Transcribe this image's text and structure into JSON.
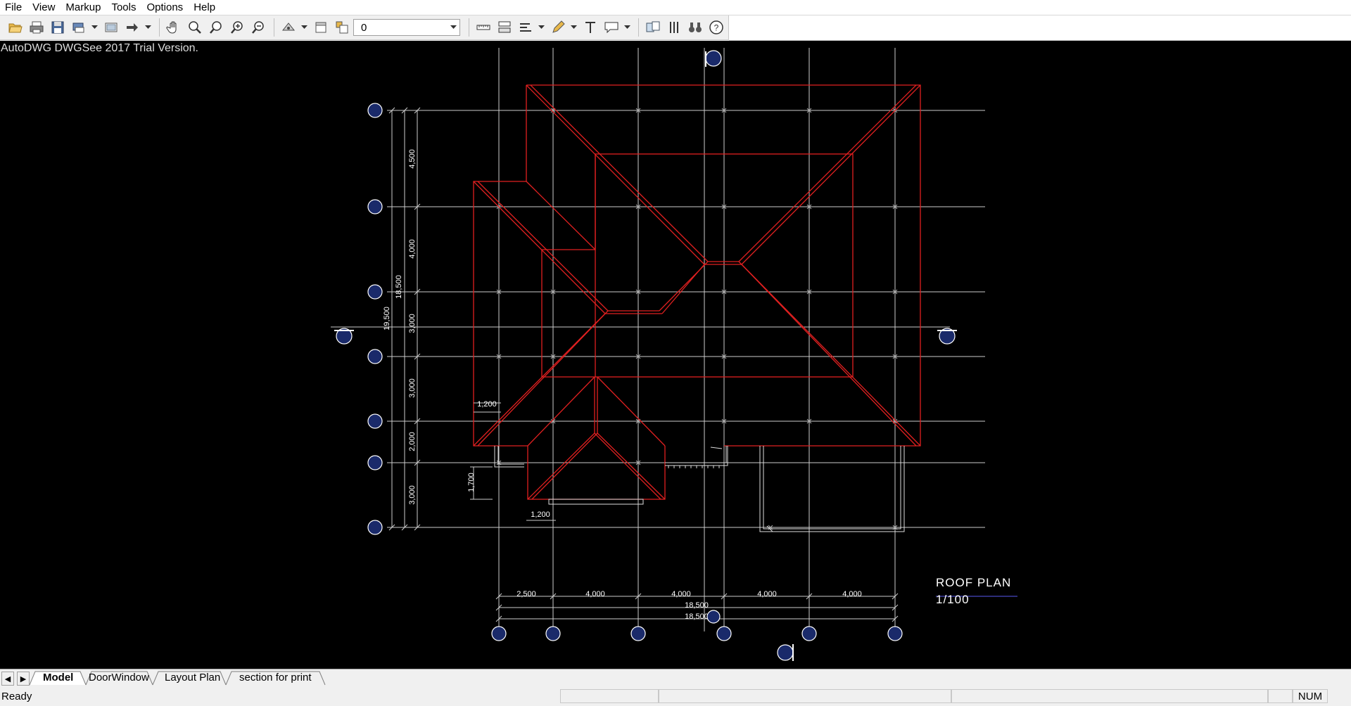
{
  "menu": {
    "items": [
      "File",
      "View",
      "Markup",
      "Tools",
      "Options",
      "Help"
    ]
  },
  "toolbar": {
    "layer_value": "0",
    "icons": [
      "open-icon",
      "print-icon",
      "save-icon",
      "batch-print-icon",
      "paper-space-icon",
      "arrow-icon",
      "pan-hand-icon",
      "zoom-realtime-icon",
      "zoom-window-icon",
      "zoom-in-icon",
      "zoom-out-icon",
      "layer-visibility-icon",
      "layer-properties-icon",
      "color-icon",
      "dimension-icon",
      "measure-icon",
      "measure-area-icon",
      "pencil-icon",
      "text-icon",
      "callout-icon",
      "compare-icon",
      "split-icon",
      "binoculars-icon",
      "help-icon"
    ]
  },
  "canvas": {
    "watermark": "AutoDWG DWGSee 2017 Trial Version.",
    "background": "#000000",
    "line_color": "#e8e8e8",
    "roof_color": "#e02020",
    "bubble_color": "#1a2a6a",
    "title": "ROOF PLAN",
    "scale": "1/100",
    "left_dims": [
      "4,500",
      "4,000",
      "3,000",
      "3,000",
      "2,000",
      "3,000"
    ],
    "left_totals": [
      "18,500",
      "19,500"
    ],
    "bottom_dims": [
      "2,500",
      "4,000",
      "4,000",
      "4,000",
      "4,000"
    ],
    "bottom_totals": [
      "18,500",
      "18,500"
    ],
    "small_dims": [
      "1,200",
      "1,700",
      "1,200"
    ]
  },
  "tabs": {
    "items": [
      "Model",
      "DoorWindow",
      "Layout Plan",
      "section for print"
    ],
    "active": "Model"
  },
  "status": {
    "text": "Ready",
    "num": "NUM"
  }
}
